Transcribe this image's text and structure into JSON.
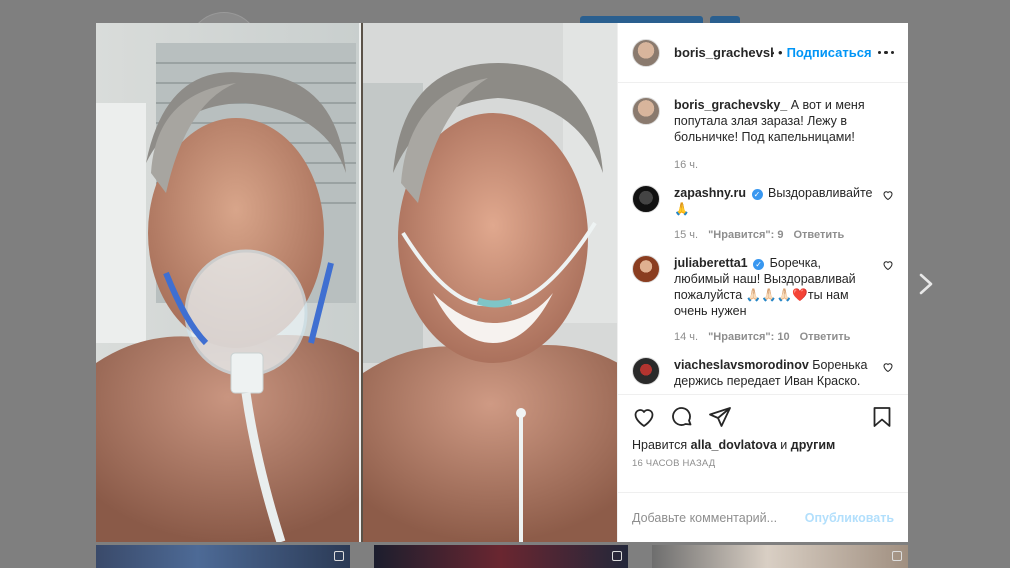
{
  "post": {
    "author": "boris_grachevsky_",
    "author_short": "boris_grachevsky_",
    "separator": "•",
    "follow_label": "Подписаться",
    "caption": "А вот и меня попутала злая зараза! Лежу в больничке! Под капельницами!",
    "caption_time": "16 ч."
  },
  "comments": [
    {
      "user": "zapashny.ru",
      "verified": true,
      "text": "Выздоравливайте 🙏",
      "time": "15 ч.",
      "likes": "\"Нравится\": 9",
      "reply": "Ответить"
    },
    {
      "user": "juliaberetta1",
      "verified": true,
      "text": "Боречка, любимый наш! Выздоравливай пожалуйста 🙏🏻🙏🏻🙏🏻❤️ты нам очень нужен",
      "time": "14 ч.",
      "likes": "\"Нравится\": 10",
      "reply": "Ответить"
    },
    {
      "user": "viacheslavsmorodinov",
      "verified": false,
      "text": "Боренька держись передает Иван Краско.",
      "time": "",
      "likes": "",
      "reply": ""
    }
  ],
  "likes_line": {
    "prefix": "Нравится",
    "user": "alla_dovlatova",
    "middle": "и",
    "suffix": "другим"
  },
  "post_time": "16 ЧАСОВ НАЗАД",
  "add_comment": {
    "placeholder": "Добавьте комментарий...",
    "post_label": "Опубликовать"
  },
  "colors": {
    "accent": "#0095f6",
    "verified": "#3897f0",
    "post_disabled": "#b2dffc",
    "overlay": "#7f7f7f"
  },
  "icons": [
    "more-icon",
    "heart-icon",
    "comment-icon",
    "share-icon",
    "bookmark-icon",
    "verified-icon",
    "next-arrow-icon"
  ]
}
